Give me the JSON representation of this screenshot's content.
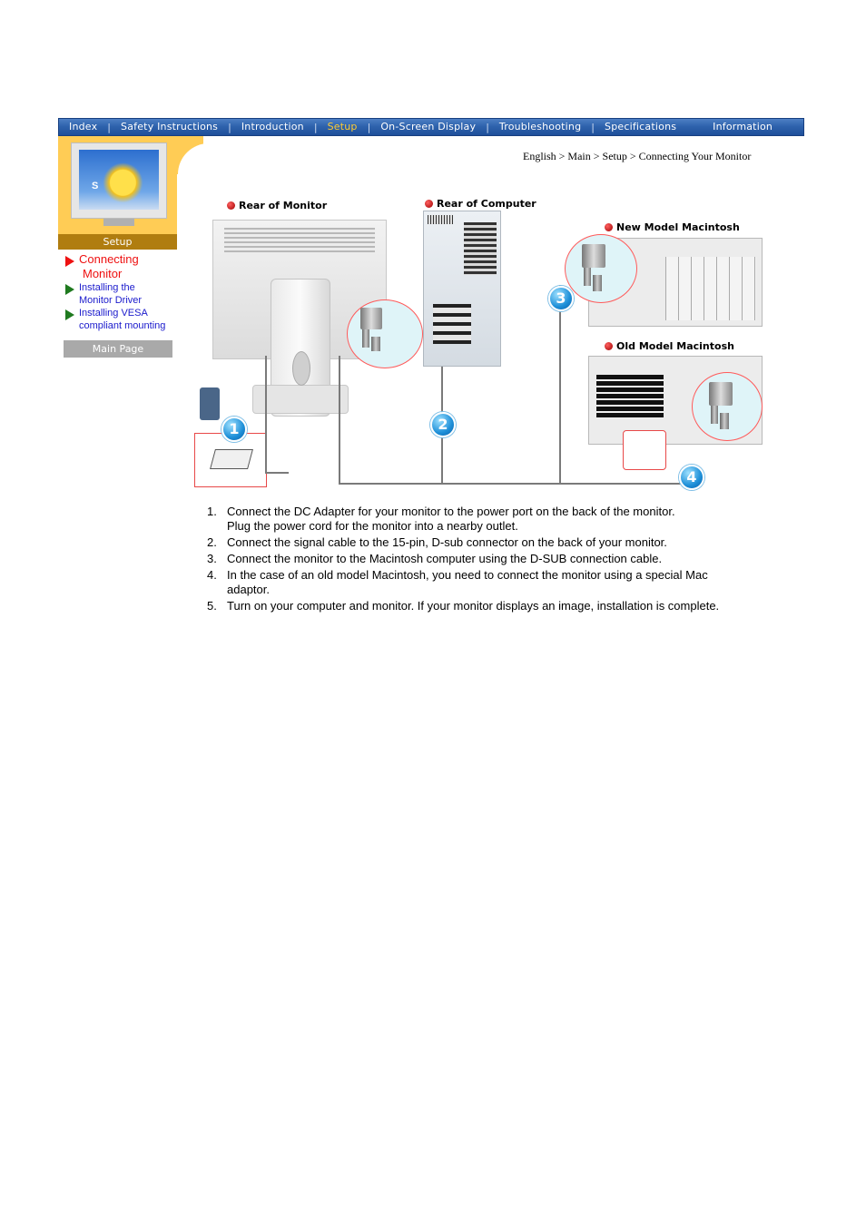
{
  "nav": {
    "items": [
      {
        "label": "Index",
        "active": false
      },
      {
        "label": "Safety Instructions",
        "active": false
      },
      {
        "label": "Introduction",
        "active": false
      },
      {
        "label": "Setup",
        "active": true
      },
      {
        "label": "On-Screen Display",
        "active": false
      },
      {
        "label": "Troubleshooting",
        "active": false
      },
      {
        "label": "Specifications",
        "active": false
      },
      {
        "label": "Information",
        "active": false
      }
    ],
    "separator": "|",
    "colors": {
      "bar": "#2f63ad",
      "active_text": "#ffcc33",
      "text": "#ffffff"
    }
  },
  "sidebar": {
    "section_label": "Setup",
    "monitor_letter": "S",
    "links": [
      {
        "line1": "Connecting",
        "line2": "Monitor",
        "current": true
      },
      {
        "line1": "Installing the",
        "line2": "Monitor Driver",
        "current": false
      },
      {
        "line1": "Installing VESA",
        "line2": "compliant mounting",
        "current": false
      }
    ],
    "main_page_button": "Main Page",
    "colors": {
      "header_bg": "#ffcc55",
      "label_bg": "#b07d10",
      "current_link": "#ee1111",
      "link": "#1a1acc",
      "bullet": "#1f7a1f"
    }
  },
  "breadcrumb": "English > Main > Setup > Connecting Your Monitor",
  "diagram": {
    "labels": {
      "rear_monitor": "Rear of Monitor",
      "rear_computer": "Rear of Computer",
      "new_mac": "New Model Macintosh",
      "old_mac": "Old Model Macintosh"
    },
    "badges": [
      "1",
      "2",
      "3",
      "4"
    ]
  },
  "steps": [
    {
      "num": "1.",
      "text": "Connect the DC Adapter for your monitor to the power port on the back of the monitor.",
      "text2": "Plug the power cord for the monitor into a nearby outlet."
    },
    {
      "num": "2.",
      "text": "Connect the signal cable to the 15-pin, D-sub connector on the back of your monitor.",
      "text2": ""
    },
    {
      "num": "3.",
      "text": "Connect the monitor to the Macintosh computer using the D-SUB connection cable.",
      "text2": ""
    },
    {
      "num": "4.",
      "text": "In the case of an old model Macintosh, you need to connect the monitor using a special Mac",
      "text2": "adaptor."
    },
    {
      "num": "5.",
      "text": "Turn on your computer and monitor. If your monitor displays an image, installation is complete.",
      "text2": ""
    }
  ]
}
